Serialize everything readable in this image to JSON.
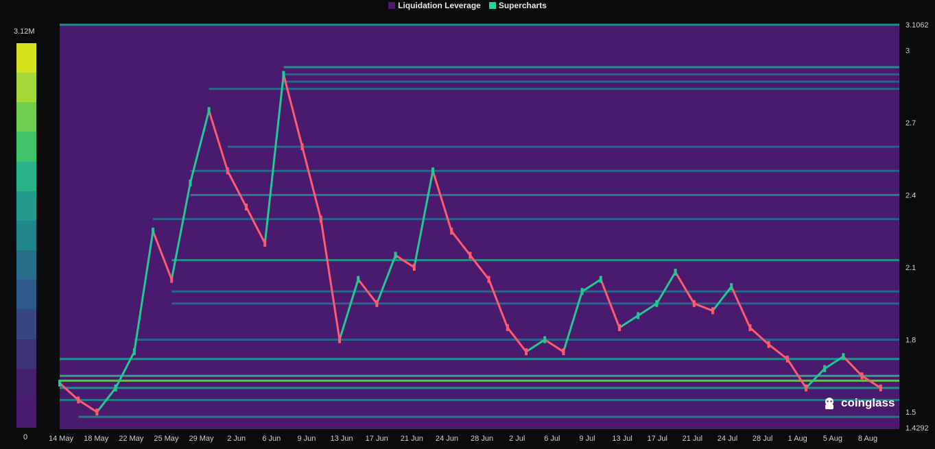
{
  "legend": {
    "items": [
      {
        "label": "Liquidation Leverage",
        "color": "#4a1a6e"
      },
      {
        "label": "Supercharts",
        "color": "#22d39a"
      }
    ]
  },
  "colorbar": {
    "max_label": "3.12M",
    "min_label": "0",
    "colors": [
      "#d6e21e",
      "#a6d83a",
      "#6ecf4e",
      "#3fc46a",
      "#27b287",
      "#229a8e",
      "#22868d",
      "#266f8c",
      "#2d5a88",
      "#354681",
      "#3c3377",
      "#44216c",
      "#4a1a6e"
    ]
  },
  "watermark": {
    "text": "coinglass"
  },
  "colors": {
    "background": "#4a1a6e",
    "candle_up": "#22c993",
    "candle_down": "#ff5b6e"
  },
  "chart_data": {
    "type": "heatmap",
    "x_tick_labels": [
      "14 May",
      "18 May",
      "22 May",
      "25 May",
      "29 May",
      "2 Jun",
      "6 Jun",
      "9 Jun",
      "13 Jun",
      "17 Jun",
      "21 Jun",
      "24 Jun",
      "28 Jun",
      "2 Jul",
      "6 Jul",
      "9 Jul",
      "13 Jul",
      "17 Jul",
      "21 Jul",
      "24 Jul",
      "28 Jul",
      "1 Aug",
      "5 Aug",
      "8 Aug"
    ],
    "y_tick_labels": [
      "3.1062",
      "3",
      "2.7",
      "2.4",
      "2.1",
      "1.8",
      "1.5",
      "1.4292"
    ],
    "y_tick_values": [
      3.1062,
      3.0,
      2.7,
      2.4,
      2.1,
      1.8,
      1.5,
      1.4292
    ],
    "ylim": [
      1.4292,
      3.1062
    ],
    "price_series_days_from_14_may": [
      0,
      2,
      4,
      6,
      8,
      10,
      12,
      14,
      16,
      18,
      20,
      22,
      24,
      26,
      28,
      30,
      32,
      34,
      36,
      38,
      40,
      42,
      44,
      46,
      48,
      50,
      52,
      54,
      56,
      58,
      60,
      62,
      64,
      66,
      68,
      70,
      72,
      74,
      76,
      78,
      80,
      82,
      84,
      86,
      88
    ],
    "price_series_close": [
      1.62,
      1.55,
      1.5,
      1.6,
      1.75,
      2.25,
      2.05,
      2.45,
      2.75,
      2.5,
      2.35,
      2.2,
      2.9,
      2.6,
      2.3,
      1.8,
      2.05,
      1.95,
      2.15,
      2.1,
      2.5,
      2.25,
      2.15,
      2.05,
      1.85,
      1.75,
      1.8,
      1.75,
      2.0,
      2.05,
      1.85,
      1.9,
      1.95,
      2.08,
      1.95,
      1.92,
      2.02,
      1.85,
      1.78,
      1.72,
      1.6,
      1.68,
      1.73,
      1.65,
      1.6
    ],
    "liquidation_levels": [
      {
        "price": 3.1062,
        "intensity": 0.55
      },
      {
        "price": 2.93,
        "intensity": 0.55
      },
      {
        "price": 2.9,
        "intensity": 0.45
      },
      {
        "price": 2.87,
        "intensity": 0.4
      },
      {
        "price": 2.84,
        "intensity": 0.45
      },
      {
        "price": 2.6,
        "intensity": 0.4
      },
      {
        "price": 2.5,
        "intensity": 0.45
      },
      {
        "price": 2.4,
        "intensity": 0.5
      },
      {
        "price": 2.3,
        "intensity": 0.4
      },
      {
        "price": 2.13,
        "intensity": 0.6
      },
      {
        "price": 2.0,
        "intensity": 0.4
      },
      {
        "price": 1.95,
        "intensity": 0.45
      },
      {
        "price": 1.8,
        "intensity": 0.45
      },
      {
        "price": 1.72,
        "intensity": 0.55
      },
      {
        "price": 1.65,
        "intensity": 0.65
      },
      {
        "price": 1.63,
        "intensity": 0.8
      },
      {
        "price": 1.6,
        "intensity": 0.6
      },
      {
        "price": 1.55,
        "intensity": 0.5
      },
      {
        "price": 1.48,
        "intensity": 0.5
      }
    ]
  }
}
